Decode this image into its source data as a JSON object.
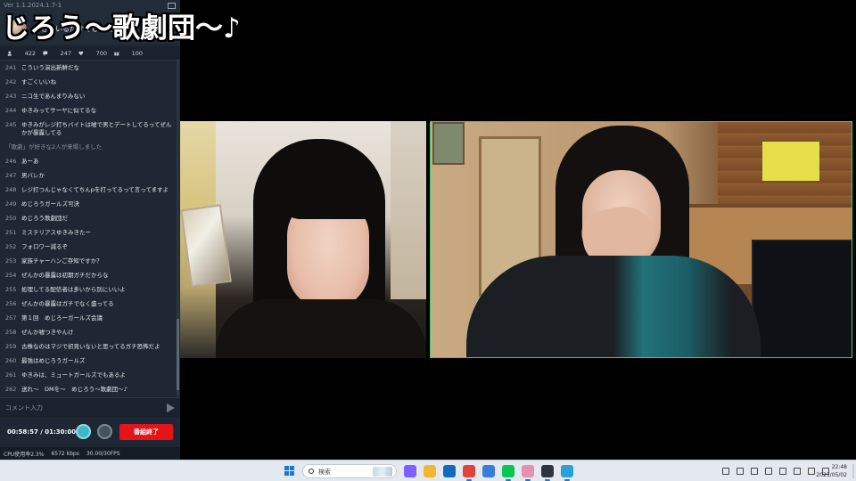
{
  "overlay": {
    "title": "じろう〜歌劇団〜♪"
  },
  "panel": {
    "version": "Ver 1.1.2024.1.7-1",
    "broadcast_title": "ゆきみいるだけでも地獄になる",
    "stats": [
      {
        "icon": "person-icon",
        "value": "422"
      },
      {
        "icon": "comment-icon",
        "value": "247"
      },
      {
        "icon": "heart-icon",
        "value": "700"
      },
      {
        "icon": "gift-icon",
        "value": "100"
      }
    ],
    "comments": [
      {
        "num": "241",
        "text": "こういう演出新鮮だな"
      },
      {
        "num": "242",
        "text": "すごくいいね"
      },
      {
        "num": "243",
        "text": "ニコ生であんまりみない"
      },
      {
        "num": "244",
        "text": "ゆきみってサーヤに似てるな"
      },
      {
        "num": "245",
        "text": "ゆきみがレジ打ちバイトは嘘で男とデートしてるってぜんかが暴露してる"
      },
      {
        "num": "",
        "text": "「歌劇」が好きな2人が来場しました",
        "notice": true
      },
      {
        "num": "246",
        "text": "あーあ"
      },
      {
        "num": "247",
        "text": "男バレか"
      },
      {
        "num": "248",
        "text": "レジ打つんじゃなくてちんpを打ってるって言ってますよ"
      },
      {
        "num": "249",
        "text": "めじろうガールズ可決"
      },
      {
        "num": "250",
        "text": "めじろう歌劇団だ"
      },
      {
        "num": "251",
        "text": "ミステリアスゆきみきたー"
      },
      {
        "num": "252",
        "text": "フォロワー減るぞ"
      },
      {
        "num": "253",
        "text": "家族チャーハンご存知ですか？"
      },
      {
        "num": "254",
        "text": "ぜんかの暴露は初期ガチだからな"
      },
      {
        "num": "255",
        "text": "処理してる配信者は多いから別にいいよ"
      },
      {
        "num": "256",
        "text": "ぜんかの暴露はガチでなく盛ってる"
      },
      {
        "num": "257",
        "text": "第１回　めじろーガールズ会議"
      },
      {
        "num": "258",
        "text": "ぜんか嘘つきやんけ"
      },
      {
        "num": "259",
        "text": "古株なのはマジで初見いないと思ってるガチ恐怖だよ"
      },
      {
        "num": "260",
        "text": "最強はめじろうガールズ"
      },
      {
        "num": "261",
        "text": "ゆきみは、ミュートガールズでもあるよ"
      },
      {
        "num": "262",
        "text": "送れ～　DMを～　めじろう～歌劇団～♪"
      }
    ],
    "comment_placeholder": "コメント入力",
    "timer": "00:58:57 / 01:30:00",
    "end_button": "番組終了",
    "status": {
      "cpu": "CPU使用率2.3%",
      "bitrate": "6572 kbps",
      "fps": "30.00/30FPS"
    }
  },
  "taskbar": {
    "search_placeholder": "検索",
    "clock_time": "22:48",
    "clock_date": "2025/05/02",
    "apps": [
      {
        "icon": "copilot-icon",
        "color": "#7b61ff"
      },
      {
        "icon": "file-explorer-icon",
        "color": "#f2b632"
      },
      {
        "icon": "outlook-icon",
        "color": "#0f6cbd"
      },
      {
        "icon": "chrome-icon",
        "color": "#e0433b"
      },
      {
        "icon": "chrome-profile-icon",
        "color": "#3a7be0"
      },
      {
        "icon": "line-icon",
        "color": "#06c755"
      },
      {
        "icon": "app-pink-icon",
        "color": "#e58fb3"
      },
      {
        "icon": "obs-icon",
        "color": "#2d3540"
      },
      {
        "icon": "app-window-icon",
        "color": "#2aa2d8"
      }
    ]
  }
}
